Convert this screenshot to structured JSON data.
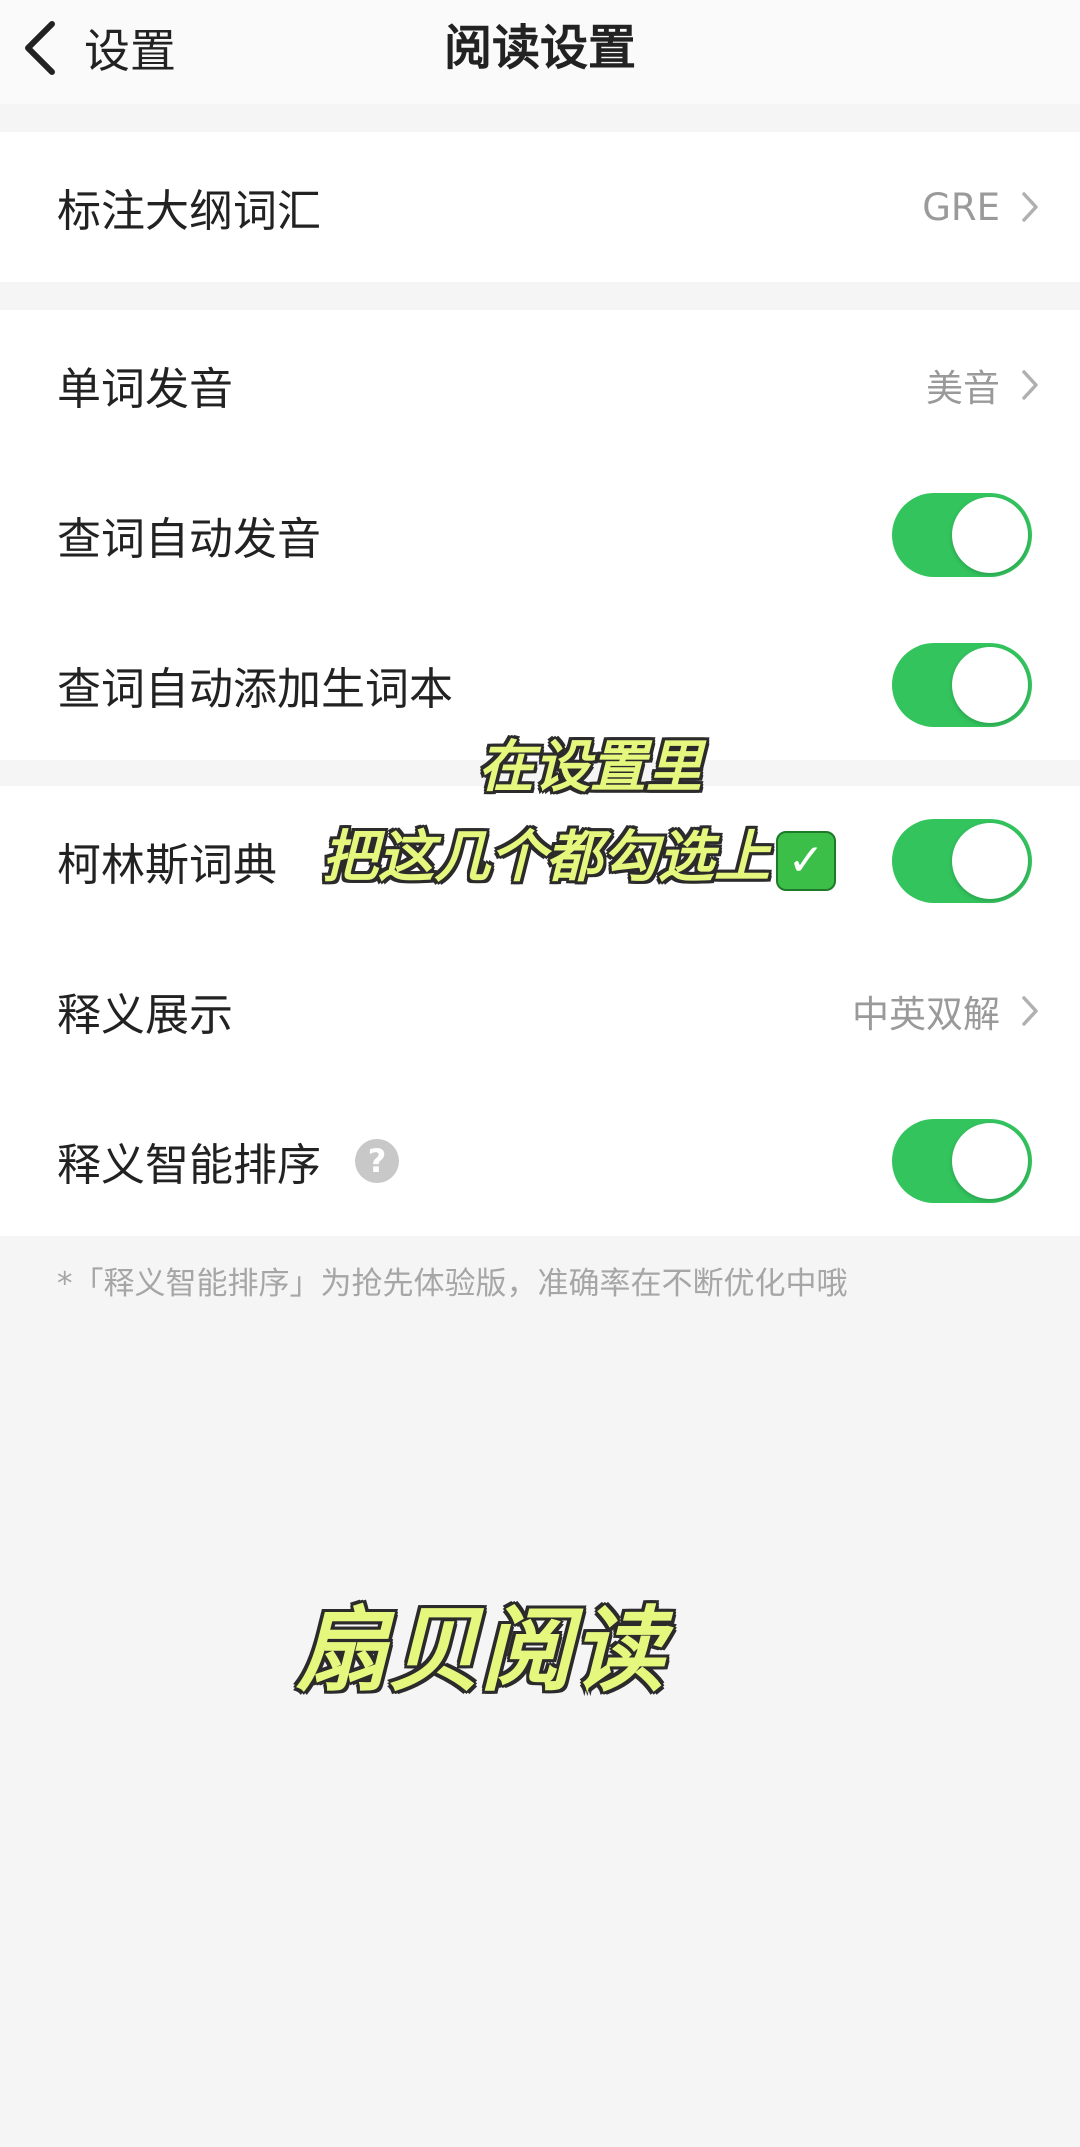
{
  "navbar": {
    "back_label": "设置",
    "title": "阅读设置"
  },
  "group1": {
    "rows": [
      {
        "label": "标注大纲词汇",
        "value": "GRE"
      }
    ]
  },
  "group2": {
    "rows": [
      {
        "label": "单词发音",
        "value": "美音"
      },
      {
        "label": "查词自动发音",
        "toggle": true
      },
      {
        "label": "查词自动添加生词本",
        "toggle": true
      }
    ]
  },
  "group3": {
    "rows": [
      {
        "label": "柯林斯词典",
        "toggle": true
      },
      {
        "label": "释义展示",
        "value": "中英双解"
      },
      {
        "label": "释义智能排序",
        "help": "?",
        "toggle": true
      }
    ]
  },
  "footnote": "*「释义智能排序」为抢先体验版，准确率在不断优化中哦",
  "overlay": {
    "line1": "在设置里",
    "line2": "把这几个都勾选上",
    "check_mark": "✓",
    "brand": "扇贝阅读"
  },
  "colors": {
    "toggle_on": "#33c45e",
    "overlay_fill": "#e6f77e",
    "background": "#f5f5f5"
  }
}
